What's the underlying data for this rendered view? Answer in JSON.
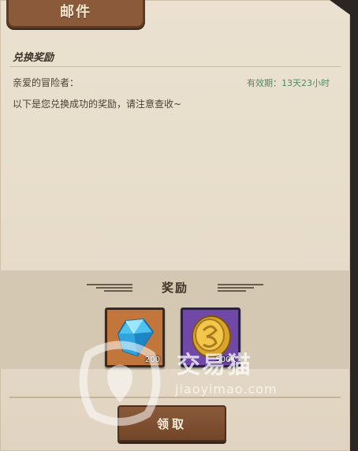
{
  "mail": {
    "tab_title": "邮件",
    "subject": "兑换奖励",
    "greeting": "亲爱的冒险者：",
    "expiry": "有效期：13天23小时",
    "body": "以下是您兑换成功的奖励，请注意查收~"
  },
  "rewards": {
    "title": "奖励",
    "items": [
      {
        "icon": "diamond-gem-icon",
        "quantity": "200"
      },
      {
        "icon": "gold-coin-icon",
        "quantity": "500K"
      }
    ]
  },
  "actions": {
    "claim_label": "领取"
  },
  "watermark": {
    "brand": "交易猫",
    "url": "jiaoyimao.com"
  },
  "colors": {
    "paper": "#e6dcc9",
    "tab_brown": "#8a5a3a",
    "expiry_green": "#4e8a5d",
    "gem_slot": "#c2763b",
    "coin_slot": "#6f48a8"
  }
}
